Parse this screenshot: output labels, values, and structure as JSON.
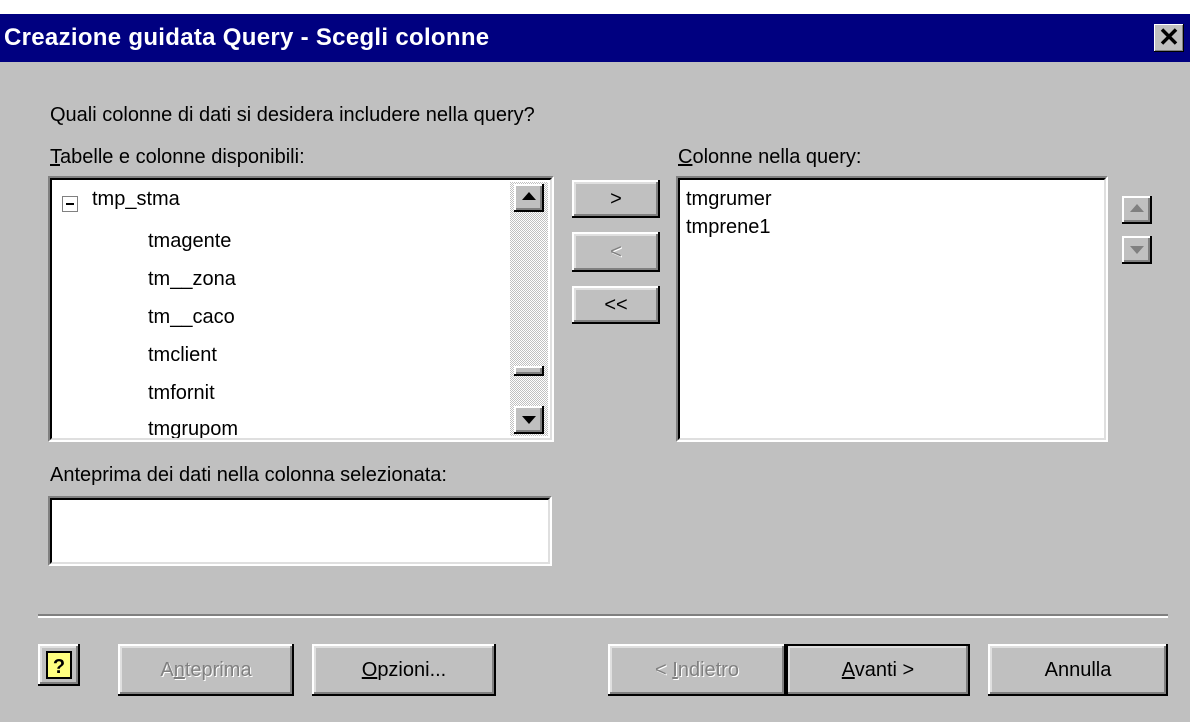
{
  "window": {
    "title": "Creazione guidata Query - Scegli colonne",
    "close_label": "✕"
  },
  "prompt": "Quali colonne di dati si desidera includere nella query?",
  "available": {
    "label_accel": "T",
    "label_rest": "abelle e colonne disponibili:",
    "table_name": "tmp_stma",
    "columns": [
      "tmagente",
      "tm__zona",
      "tm__caco",
      "tmclient",
      "tmfornit",
      "tmgrupom"
    ]
  },
  "move_buttons": {
    "add": ">",
    "remove": "<",
    "remove_all": "<<"
  },
  "selected": {
    "label_accel": "C",
    "label_rest": "olonne nella query:",
    "columns": [
      "tmgrumer",
      "tmprene1"
    ]
  },
  "preview": {
    "label": "Anteprima dei dati nella colonna selezionata:",
    "value": ""
  },
  "footer": {
    "help_icon": "?",
    "preview_pre": "A",
    "preview_accel": "n",
    "preview_post": "teprima",
    "options_accel": "O",
    "options_rest": "pzioni...",
    "back_pre": "< ",
    "back_accel": "I",
    "back_post": "ndietro",
    "next_accel": "A",
    "next_rest": "vanti >",
    "cancel": "Annulla"
  }
}
